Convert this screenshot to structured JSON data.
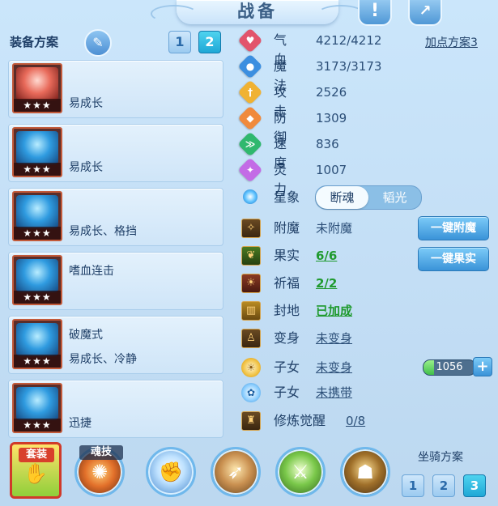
{
  "title": "战备",
  "header_icons": [
    "alert-icon",
    "share-icon"
  ],
  "equip_section": {
    "title": "装备方案",
    "plans": [
      "1",
      "2"
    ],
    "active_plan": 2
  },
  "equipment": [
    {
      "stars": "★★★",
      "line1": "",
      "line2": "易成长",
      "icon": "sword-icon"
    },
    {
      "stars": "★★★",
      "line1": "",
      "line2": "易成长",
      "icon": "helmet-icon"
    },
    {
      "stars": "★★★",
      "line1": "",
      "line2": "易成长、格挡",
      "icon": "armor-icon"
    },
    {
      "stars": "★★★",
      "line1": "嗜血连击",
      "line2": "",
      "icon": "necklace-icon"
    },
    {
      "stars": "★★★",
      "line1": "破魔式",
      "line2": "易成长、冷静",
      "icon": "belt-icon"
    },
    {
      "stars": "★★★",
      "line1": "",
      "line2": "迅捷",
      "icon": "boots-icon"
    }
  ],
  "stats": [
    {
      "label": "气血",
      "value": "4212/4212",
      "icon": "heart-icon",
      "color": "#e2546c"
    },
    {
      "label": "魔法",
      "value": "3173/3173",
      "icon": "mana-icon",
      "color": "#3c8fe0"
    },
    {
      "label": "攻击",
      "value": "2526",
      "icon": "attack-icon",
      "color": "#f0b232"
    },
    {
      "label": "防御",
      "value": "1309",
      "icon": "defense-icon",
      "color": "#f08a3c"
    },
    {
      "label": "速度",
      "value": "836",
      "icon": "speed-icon",
      "color": "#2fb86e"
    },
    {
      "label": "灵力",
      "value": "1007",
      "icon": "spirit-icon",
      "color": "#c36be6"
    }
  ],
  "addpoint_link": "加点方案3",
  "star": {
    "label": "星象",
    "options": [
      "断魂",
      "韬光"
    ],
    "selected": 0
  },
  "attachments": [
    {
      "label": "附魔",
      "value": "未附魔",
      "icon": "enchant-icon",
      "style": "plain"
    },
    {
      "label": "果实",
      "value": "6/6",
      "icon": "fruit-icon",
      "style": "green"
    },
    {
      "label": "祈福",
      "value": "2/2",
      "icon": "bless-icon",
      "style": "green"
    },
    {
      "label": "封地",
      "value": "已加成",
      "icon": "fief-icon",
      "style": "green"
    },
    {
      "label": "变身",
      "value": "未变身",
      "icon": "transform-icon",
      "style": "underline"
    },
    {
      "label": "子女",
      "value": "未变身",
      "icon": "child-sun-icon",
      "style": "underline"
    },
    {
      "label": "子女",
      "value": "未携带",
      "icon": "child-paw-icon",
      "style": "underline"
    },
    {
      "label": "修炼觉醒",
      "value": "0/8",
      "icon": "cultivate-icon",
      "style": "underline"
    }
  ],
  "buttons": {
    "enchant": "一键附魔",
    "fruit": "一键果实"
  },
  "child_exp": {
    "value": "1056",
    "fill": 0.2
  },
  "bottom": {
    "suit_label": "套装",
    "soul_label": "魂技",
    "skills": [
      "fist-icon",
      "bow-icon",
      "sword-skill-icon",
      "shadow-icon"
    ]
  },
  "mount": {
    "title": "坐骑方案",
    "plans": [
      "1",
      "2",
      "3"
    ],
    "active": 3
  }
}
